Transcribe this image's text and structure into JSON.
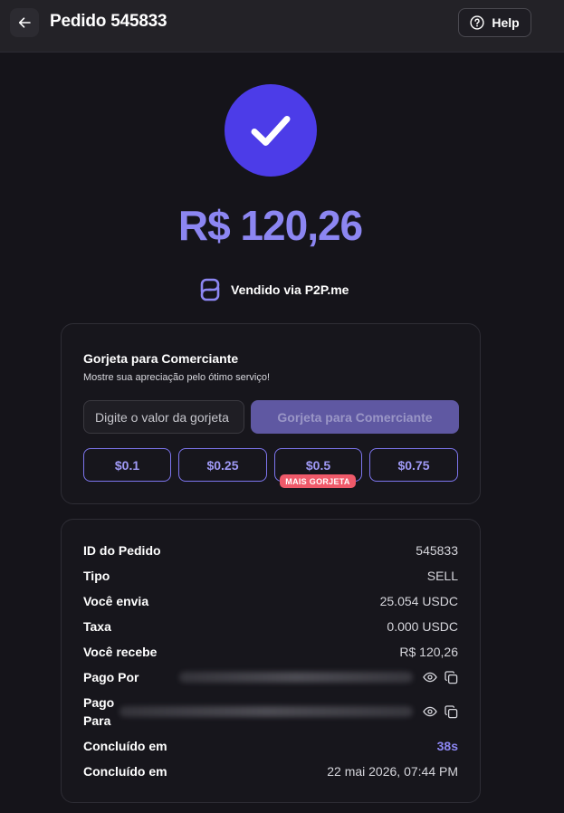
{
  "header": {
    "title": "Pedido 545833",
    "help_label": "Help"
  },
  "status": {
    "amount": "R$ 120,26",
    "sold_via": "Vendido via P2P.me"
  },
  "tip": {
    "title": "Gorjeta para Comerciante",
    "subtitle": "Mostre sua apreciação pelo ótimo serviço!",
    "input_placeholder": "Digite o valor da gorjeta",
    "input_value": "",
    "submit_label": "Gorjeta para Comerciante",
    "amounts": [
      "$0.1",
      "$0.25",
      "$0.5",
      "$0.75"
    ],
    "badge": "MAIS GORJETA"
  },
  "details": {
    "order_id_label": "ID do Pedido",
    "order_id": "545833",
    "type_label": "Tipo",
    "type": "SELL",
    "you_send_label": "Você envia",
    "you_send": "25.054 USDC",
    "fee_label": "Taxa",
    "fee": "0.000 USDC",
    "you_receive_label": "Você recebe",
    "you_receive": "R$ 120,26",
    "paid_by_label": "Pago Por",
    "paid_to_label_line1": "Pago",
    "paid_to_label_line2": "Para",
    "completed_in_label": "Concluído em",
    "completed_in": "38s",
    "completed_at_label": "Concluído em",
    "completed_at": "22 mai 2026, 07:44 PM"
  },
  "colors": {
    "accent": "#4c3ce8",
    "accent_light": "#8c86f2",
    "badge": "#ef5a6a",
    "background": "#15141a"
  },
  "icons": {
    "back": "arrow-left-icon",
    "help": "question-circle-icon",
    "success": "check-icon",
    "brand": "p2p-logo-icon",
    "reveal": "eye-icon",
    "copy": "copy-icon"
  }
}
